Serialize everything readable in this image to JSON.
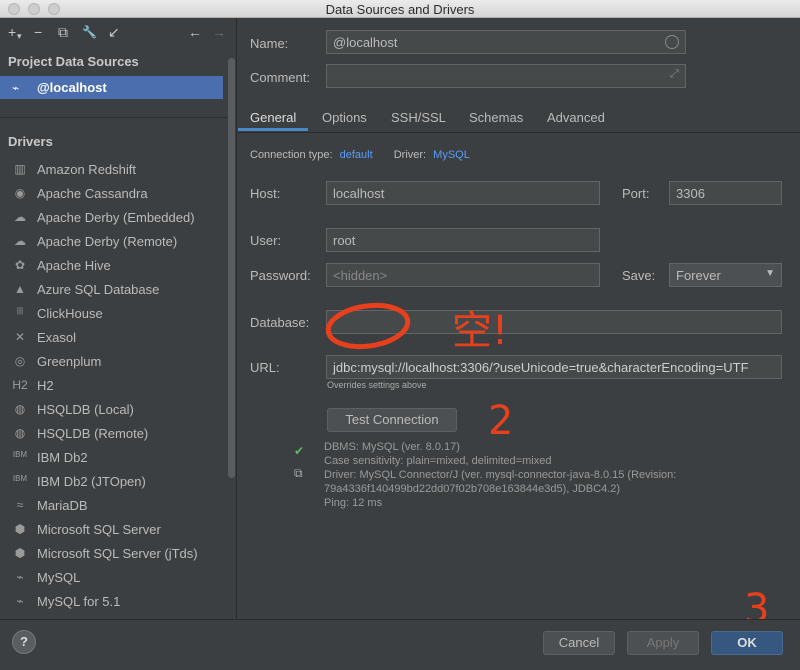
{
  "window": {
    "title": "Data Sources and Drivers"
  },
  "left_panel": {
    "toolbar": {
      "add": "+",
      "add_arrow": "▾",
      "remove": "−",
      "duplicate": "⧉",
      "settings": "🔧",
      "import": "↙",
      "back": "←",
      "forward": "→"
    },
    "project_header": "Project Data Sources",
    "selected_source": "@localhost",
    "drivers_header": "Drivers",
    "drivers": [
      {
        "label": "Amazon Redshift",
        "icon": "▥"
      },
      {
        "label": "Apache Cassandra",
        "icon": "◉"
      },
      {
        "label": "Apache Derby (Embedded)",
        "icon": "☁"
      },
      {
        "label": "Apache Derby (Remote)",
        "icon": "☁"
      },
      {
        "label": "Apache Hive",
        "icon": "✿"
      },
      {
        "label": "Azure SQL Database",
        "icon": "▲"
      },
      {
        "label": "ClickHouse",
        "icon": "|||"
      },
      {
        "label": "Exasol",
        "icon": "✕"
      },
      {
        "label": "Greenplum",
        "icon": "◎"
      },
      {
        "label": "H2",
        "icon": "H2"
      },
      {
        "label": "HSQLDB (Local)",
        "icon": "◍"
      },
      {
        "label": "HSQLDB (Remote)",
        "icon": "◍"
      },
      {
        "label": "IBM Db2",
        "icon": "IBM"
      },
      {
        "label": "IBM Db2 (JTOpen)",
        "icon": "IBM"
      },
      {
        "label": "MariaDB",
        "icon": "≈"
      },
      {
        "label": "Microsoft SQL Server",
        "icon": "⬢"
      },
      {
        "label": "Microsoft SQL Server (jTds)",
        "icon": "⬢"
      },
      {
        "label": "MySQL",
        "icon": "⌁"
      },
      {
        "label": "MySQL for 5.1",
        "icon": "⌁"
      }
    ]
  },
  "form": {
    "name_label": "Name:",
    "name_value": "@localhost",
    "comment_label": "Comment:",
    "comment_value": "",
    "tabs": [
      "General",
      "Options",
      "SSH/SSL",
      "Schemas",
      "Advanced"
    ],
    "connection_type_label": "Connection type:",
    "connection_type_value": "default",
    "driver_label": "Driver:",
    "driver_value": "MySQL",
    "host_label": "Host:",
    "host_value": "localhost",
    "port_label": "Port:",
    "port_value": "3306",
    "user_label": "User:",
    "user_value": "root",
    "password_label": "Password:",
    "password_placeholder": "<hidden>",
    "save_label": "Save:",
    "save_value": "Forever",
    "database_label": "Database:",
    "database_value": "",
    "url_label": "URL:",
    "url_value": "jdbc:mysql://localhost:3306/?useUnicode=true&characterEncoding=UTF",
    "url_hint": "Overrides settings above",
    "test_button": "Test Connection",
    "result_lines": [
      "DBMS: MySQL (ver. 8.0.17)",
      "Case sensitivity: plain=mixed, delimited=mixed",
      "Driver: MySQL Connector/J (ver. mysql-connector-java-8.0.15 (Revision:",
      "79a4336f140499bd22dd07f02b708e163844e3d5), JDBC4.2)",
      "Ping: 12 ms"
    ]
  },
  "footer": {
    "help": "?",
    "cancel": "Cancel",
    "apply": "Apply",
    "ok": "OK"
  },
  "annotations": {
    "empty_note": "空!",
    "step2": "2",
    "step3": "3"
  },
  "colors": {
    "accent": "#4b6eaf",
    "link": "#589df6",
    "annotation": "#e8401c",
    "success": "#5fb85f"
  }
}
